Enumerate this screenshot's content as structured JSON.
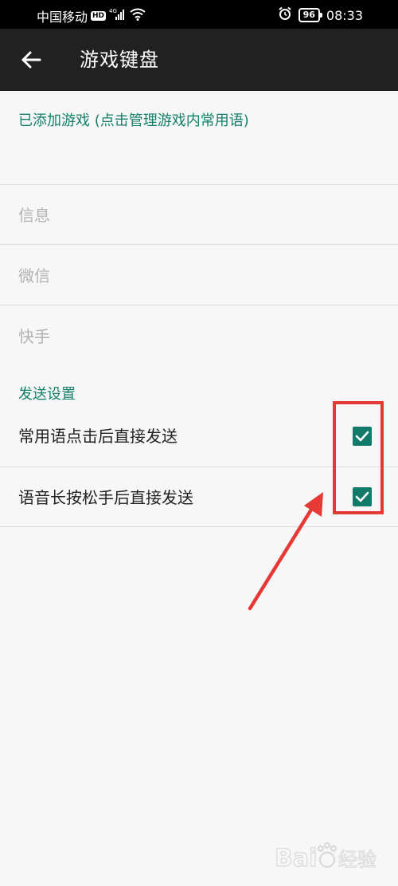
{
  "status_bar": {
    "carrier": "中国移动",
    "hd_badge": "HD",
    "network": "4G",
    "battery": "96",
    "time": "08:33"
  },
  "app_bar": {
    "title": "游戏键盘"
  },
  "added_games": {
    "header": "已添加游戏 (点击管理游戏内常用语)",
    "items": [
      {
        "label": "信息"
      },
      {
        "label": "微信"
      },
      {
        "label": "快手"
      }
    ]
  },
  "send_settings": {
    "header": "发送设置",
    "items": [
      {
        "label": "常用语点击后直接发送",
        "checked": true
      },
      {
        "label": "语音长按松手后直接发送",
        "checked": true
      }
    ]
  },
  "colors": {
    "accent": "#117a6b",
    "header_text": "#15806a",
    "annotation": "#e53935"
  },
  "watermark": {
    "text": "Bai经验"
  }
}
